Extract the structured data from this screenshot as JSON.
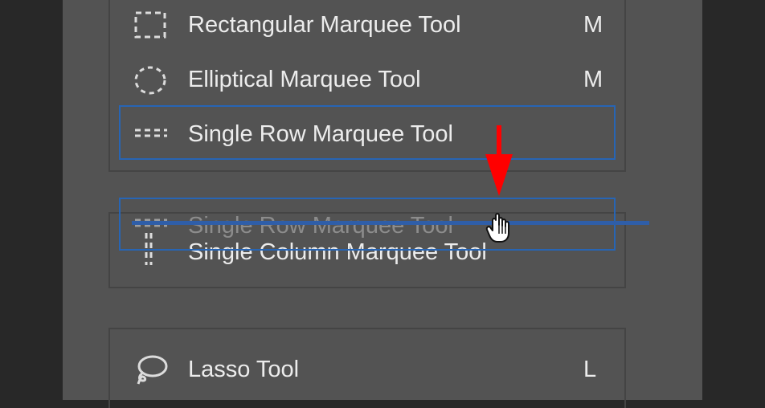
{
  "menu": {
    "items": [
      {
        "label": "Rectangular Marquee Tool",
        "shortcut": "M",
        "icon": "rectangular-marquee-icon"
      },
      {
        "label": "Elliptical Marquee Tool",
        "shortcut": "M",
        "icon": "elliptical-marquee-icon"
      },
      {
        "label": "Single Row Marquee Tool",
        "shortcut": "",
        "icon": "single-row-marquee-icon"
      },
      {
        "label": "Single Column Marquee Tool",
        "shortcut": "",
        "icon": "single-column-marquee-icon"
      },
      {
        "label": "Lasso Tool",
        "shortcut": "L",
        "icon": "lasso-icon"
      }
    ]
  },
  "drag": {
    "ghost_label": "Single Row Marquee Tool",
    "ghost_icon": "single-row-marquee-icon"
  },
  "colors": {
    "panel": "#535353",
    "background": "#282828",
    "selection": "#2765b5",
    "drop_indicator": "#2f5ea8",
    "arrow": "#ff0000"
  }
}
